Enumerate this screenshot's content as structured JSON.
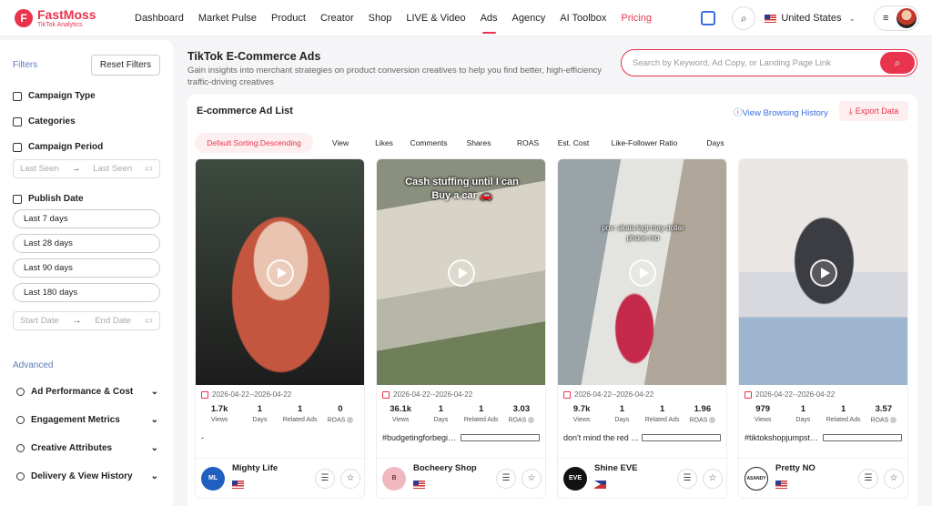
{
  "header": {
    "logo_name": "FastMoss",
    "logo_sub": "TikTok Analytics",
    "nav": [
      "Dashboard",
      "Market Pulse",
      "Product",
      "Creator",
      "Shop",
      "LIVE & Video",
      "Ads",
      "Agency",
      "AI Toolbox",
      "Pricing"
    ],
    "active_nav": "Ads",
    "country": "United States"
  },
  "sidebar": {
    "filters_label": "Filters",
    "reset_label": "Reset Filters",
    "campaign_type": "Campaign Type",
    "categories": "Categories",
    "campaign_period": "Campaign Period",
    "last_seen_start": "Last Seen",
    "last_seen_end": "Last Seen",
    "publish_date": "Publish Date",
    "date_options": [
      "Last 7 days",
      "Last 28 days",
      "Last 90 days",
      "Last 180 days"
    ],
    "start_date": "Start Date",
    "end_date": "End Date",
    "advanced": "Advanced",
    "advanced_items": [
      "Ad Performance & Cost",
      "Engagement Metrics",
      "Creative Attributes",
      "Delivery & View History"
    ]
  },
  "page": {
    "title": "TikTok E-Commerce Ads",
    "subtitle": "Gain insights into merchant strategies on product conversion creatives to help you find better, high-efficiency traffic-driving creatives",
    "search_placeholder": "Search by Keyword, Ad Copy, or Landing Page Link"
  },
  "list": {
    "title": "E-commerce Ad List",
    "history": "View Browsing History",
    "export": "Export Data",
    "sorts": [
      "Default Sorting:Descending",
      "View",
      "Likes",
      "Comments",
      "Shares",
      "ROAS",
      "Est. Cost",
      "Like-Follower Ratio",
      "Days"
    ]
  },
  "stat_labels": [
    "Views",
    "Days",
    "Related Ads",
    "ROAS"
  ],
  "cards": [
    {
      "date": "2026-04-22--2026-04-22",
      "views": "1.7k",
      "days": "1",
      "related": "1",
      "roas": "0",
      "desc": "-",
      "shop": "Mighty Life",
      "logo_text": "ML",
      "logo_color": "#1f5fbf",
      "overlay": ""
    },
    {
      "date": "2026-04-22--2026-04-22",
      "views": "36.1k",
      "days": "1",
      "related": "1",
      "roas": "3.03",
      "desc": "#budgetingforbeginners #saving…",
      "shop": "Bocheery Shop",
      "logo_text": "B",
      "logo_color": "#f0b8c0",
      "overlay": "Cash stuffing until I can Buy a car 🚗"
    },
    {
      "date": "2026-04-22--2026-04-22",
      "views": "9.7k",
      "days": "1",
      "related": "1",
      "roas": "1.96",
      "desc": "don't mind the red one😅 #iphone…",
      "shop": "Shine EVE",
      "logo_text": "EVE",
      "logo_color": "#111111",
      "overlay": "pov: akala lagi may dollar phone mo"
    },
    {
      "date": "2026-04-22--2026-04-22",
      "views": "979",
      "days": "1",
      "related": "1",
      "roas": "3.57",
      "desc": "#tiktokshopjumpstartsale #fashio…",
      "shop": "Pretty NO",
      "logo_text": "ASANDY",
      "logo_color": "#222222",
      "overlay": ""
    }
  ]
}
